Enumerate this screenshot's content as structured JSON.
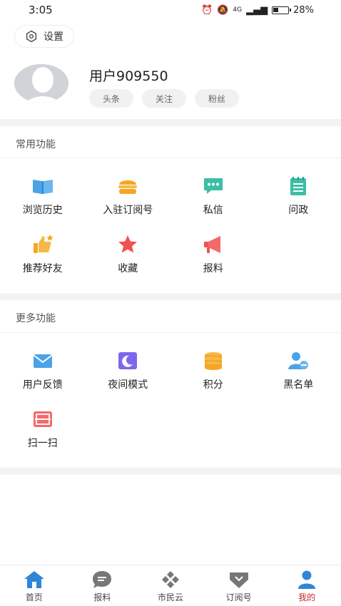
{
  "status_bar": {
    "time": "3:05",
    "network": "4G",
    "battery": "28%"
  },
  "header": {
    "settings_label": "设置"
  },
  "profile": {
    "username": "用户909550",
    "tags": [
      "头条",
      "关注",
      "粉丝"
    ]
  },
  "common": {
    "title": "常用功能",
    "items": [
      {
        "label": "浏览历史",
        "icon": "book-icon",
        "color": "#4aa3e6"
      },
      {
        "label": "入驻订阅号",
        "icon": "burger-icon",
        "color": "#f5a623"
      },
      {
        "label": "私信",
        "icon": "chat-icon",
        "color": "#3bbfa5"
      },
      {
        "label": "问政",
        "icon": "notepad-icon",
        "color": "#3bbfa5"
      },
      {
        "label": "推荐好友",
        "icon": "thumbs-up-icon",
        "color": "#f5a623"
      },
      {
        "label": "收藏",
        "icon": "star-icon",
        "color": "#ef5350"
      },
      {
        "label": "报料",
        "icon": "megaphone-icon",
        "color": "#ef5350"
      }
    ]
  },
  "more": {
    "title": "更多功能",
    "items": [
      {
        "label": "用户反馈",
        "icon": "mail-icon",
        "color": "#4aa3e6"
      },
      {
        "label": "夜间模式",
        "icon": "moon-icon",
        "color": "#7b68ee"
      },
      {
        "label": "积分",
        "icon": "coins-icon",
        "color": "#f5a623"
      },
      {
        "label": "黑名单",
        "icon": "user-block-icon",
        "color": "#4aa3e6"
      },
      {
        "label": "扫一扫",
        "icon": "scan-icon",
        "color": "#ef5350"
      }
    ]
  },
  "tabbar": {
    "items": [
      {
        "label": "首页",
        "icon": "home-icon"
      },
      {
        "label": "报料",
        "icon": "chat-bubble-icon"
      },
      {
        "label": "市民云",
        "icon": "cloud-diamonds-icon"
      },
      {
        "label": "订阅号",
        "icon": "heart-tag-icon"
      },
      {
        "label": "我的",
        "icon": "user-icon"
      }
    ],
    "active_index": 4,
    "active_color": "#c62828",
    "accent_color": "#2f86d6"
  }
}
